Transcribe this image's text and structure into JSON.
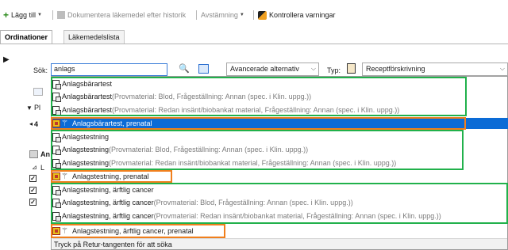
{
  "toolbar": {
    "add_label": "Lägg till",
    "document_label": "Dokumentera läkemedel efter historik",
    "reconcile_label": "Avstämning",
    "check_label": "Kontrollera varningar"
  },
  "tabs": [
    {
      "label": "Ordinationer",
      "active": true
    },
    {
      "label": "Läkemedelslista",
      "active": false
    }
  ],
  "search": {
    "label": "Sök:",
    "value": "anlags",
    "advanced_label": "Avancerade alternativ",
    "type_label": "Typ:",
    "type_value": "Receptförskrivning"
  },
  "background": {
    "collapse_marker": "▶",
    "pl_fragment": "Pl",
    "row_digit": "4",
    "an_fragment": "An",
    "l_fragment": "L"
  },
  "results": [
    {
      "name": "Anlagsbärartest",
      "detail": "",
      "icon": "doc-icon"
    },
    {
      "name": "Anlagsbärartest",
      "detail": " (Provmaterial: Blod, Frågeställning: Annan (spec. i Klin. uppg.))",
      "icon": "doc-icon"
    },
    {
      "name": "Anlagsbärartest",
      "detail": " (Provmaterial: Redan insänt/biobankat material, Frågeställning: Annan (spec. i Klin. uppg.))",
      "icon": "doc-icon"
    },
    {
      "name": "Anlagsbärartest, prenatal",
      "detail": "",
      "icon": "kit-icon",
      "selected": true
    },
    {
      "name": "Anlagstestning",
      "detail": "",
      "icon": "doc-icon"
    },
    {
      "name": "Anlagstestning",
      "detail": " (Provmaterial: Blod, Frågeställning: Annan (spec. i Klin. uppg.))",
      "icon": "doc-icon"
    },
    {
      "name": "Anlagstestning",
      "detail": " (Provmaterial: Redan insänt/biobankat material, Frågeställning: Annan (spec. i Klin. uppg.))",
      "icon": "doc-icon"
    },
    {
      "name": "Anlagstestning, prenatal",
      "detail": "",
      "icon": "kit-icon"
    },
    {
      "name": "Anlagstestning, ärftlig cancer",
      "detail": "",
      "icon": "doc-icon"
    },
    {
      "name": "Anlagstestning, ärftlig cancer",
      "detail": " (Provmaterial: Blod, Frågeställning: Annan (spec. i Klin. uppg.))",
      "icon": "doc-icon"
    },
    {
      "name": "Anlagstestning, ärftlig cancer",
      "detail": " (Provmaterial: Redan insänt/biobankat material, Frågeställning: Annan (spec. i Klin. uppg.))",
      "icon": "doc-icon"
    },
    {
      "name": "Anlagstestning, ärftlig cancer, prenatal",
      "detail": "",
      "icon": "kit-icon"
    }
  ],
  "hint": "Tryck på Retur-tangenten för att söka",
  "colors": {
    "selection": "#0b6bd6",
    "green_box": "#21b14b",
    "orange_box": "#f07f1d"
  }
}
